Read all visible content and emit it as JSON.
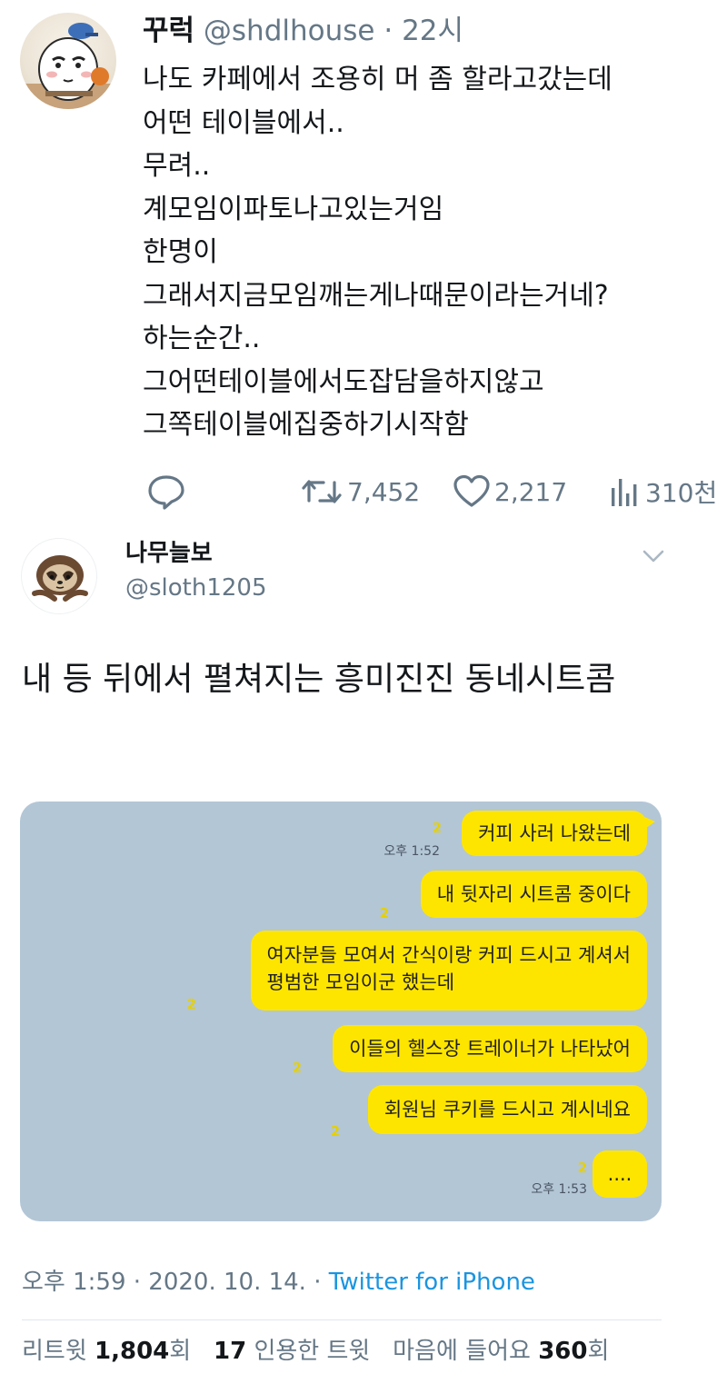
{
  "tweet1": {
    "display_name": "꾸럭",
    "handle": "@shdlhouse",
    "separator": "·",
    "time": "22시",
    "lines": [
      "나도 카페에서 조용히 머 좀 할라고갔는데",
      "어떤 테이블에서..",
      "무려..",
      "계모임이파토나고있는거임",
      "한명이",
      "그래서지금모임깨는게나때문이라는거네?",
      "하는순간..",
      "그어떤테이블에서도잡담을하지않고",
      "그쪽테이블에집중하기시작함"
    ],
    "actions": {
      "reply_icon": "comment-bubble-icon",
      "retweet_icon": "retweet-arrows-icon",
      "retweet_count": "7,452",
      "like_icon": "heart-outline-icon",
      "like_count": "2,217",
      "views_icon": "bar-chart-icon",
      "views_count": "310천"
    },
    "colors": {
      "text": "#14171a",
      "muted": "#657786"
    }
  },
  "tweet2": {
    "display_name": "나무늘보",
    "handle": "@sloth1205",
    "menu_icon": "chevron-down-icon",
    "text": "내 등 뒤에서 펼쳐지는 흥미진진 동네시트콤",
    "chat": {
      "background": "#b3c6d6",
      "bubble_color": "#fee500",
      "messages": [
        {
          "text": "커피 사러 나왔는데",
          "unread": "2",
          "time": "오후 1:52"
        },
        {
          "text": "내 뒷자리 시트콤 중이다",
          "unread": "2",
          "time": ""
        },
        {
          "text": "여자분들 모여서 간식이랑 커피 드시고 계셔서",
          "text2": "평범한 모임이군 했는데",
          "unread": "2",
          "time": ""
        },
        {
          "text": "이들의 헬스장 트레이너가 나타났어",
          "unread": "2",
          "time": ""
        },
        {
          "text": "회원님 쿠키를 드시고 계시네요",
          "unread": "2",
          "time": ""
        },
        {
          "text": "....",
          "unread": "2",
          "time": "오후 1:53"
        }
      ]
    },
    "timestamp": "오후 1:59 · 2020. 10. 14. ·",
    "source": "Twitter for iPhone",
    "stats": {
      "retweet_label": "리트윗",
      "retweet_count": "1,804",
      "retweet_unit": "회",
      "quote_count": "17",
      "quote_label": "인용한 트윗",
      "like_label": "마음에 들어요",
      "like_count": "360",
      "like_unit": "회"
    },
    "colors": {
      "link": "#1b95e0",
      "divider": "#e1e8ed"
    }
  }
}
